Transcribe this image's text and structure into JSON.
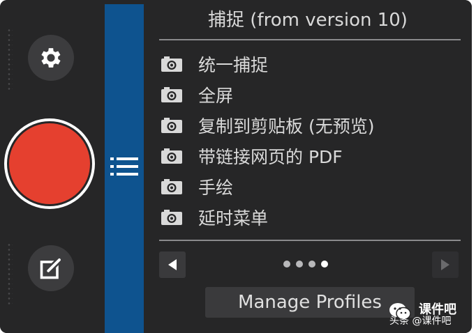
{
  "panel": {
    "title": "捕捉 (from version 10)",
    "items": [
      {
        "label": "统一捕捉",
        "icon": "camera-icon"
      },
      {
        "label": "全屏",
        "icon": "camera-icon"
      },
      {
        "label": "复制到剪贴板 (无预览)",
        "icon": "camera-icon"
      },
      {
        "label": "带链接网页的 PDF",
        "icon": "camera-icon"
      },
      {
        "label": "手绘",
        "icon": "camera-icon"
      },
      {
        "label": "延时菜单",
        "icon": "camera-icon"
      }
    ],
    "pager": {
      "pages": 4,
      "active_page": 4
    },
    "manage_profiles_label": "Manage Profiles"
  },
  "sidebar": {
    "settings_icon": "gear-icon",
    "record_icon": "record-icon",
    "editor_icon": "edit-icon",
    "menu_icon": "list-icon"
  },
  "watermark": {
    "top_text": "课件吧",
    "bottom_text": "头条 @课件吧"
  },
  "colors": {
    "background": "#262627",
    "accent_blue": "#0e538f",
    "record_red": "#e5402f",
    "text": "#d9d9d9"
  }
}
